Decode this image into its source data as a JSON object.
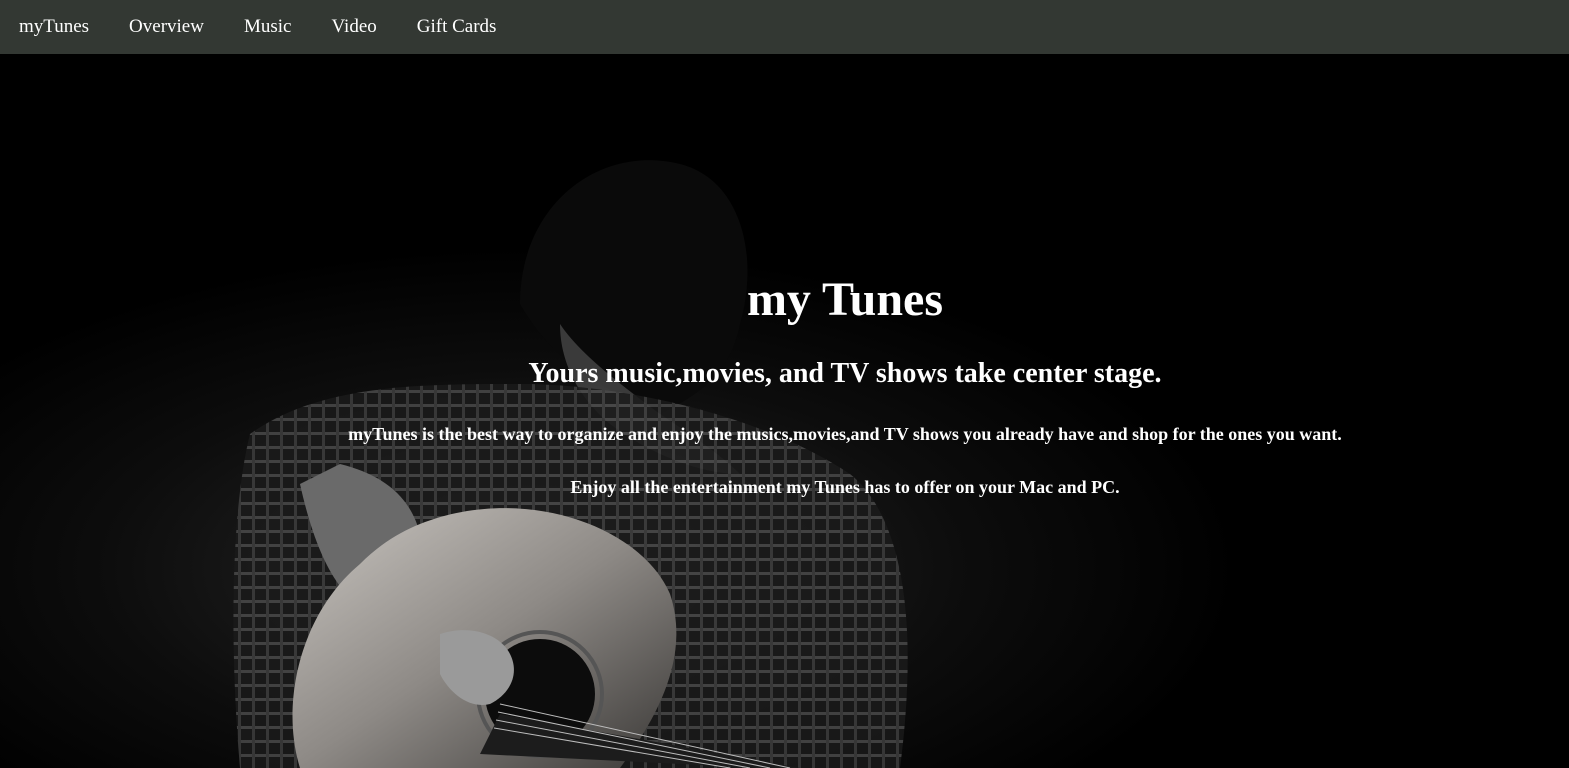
{
  "nav": {
    "items": [
      {
        "label": "myTunes"
      },
      {
        "label": "Overview"
      },
      {
        "label": "Music"
      },
      {
        "label": "Video"
      },
      {
        "label": "Gift Cards"
      }
    ]
  },
  "hero": {
    "title": "my Tunes",
    "subtitle": "Yours music,movies, and TV shows take center stage.",
    "paragraph1": "myTunes is the best way to organize and enjoy the musics,movies,and TV shows you already have and shop for the ones you want.",
    "paragraph2": "Enjoy all the entertainment my Tunes has to offer on your Mac and PC.",
    "image": "guitarist-photo"
  },
  "colors": {
    "navbar": "#333833",
    "background": "#000000",
    "text": "#ffffff"
  }
}
